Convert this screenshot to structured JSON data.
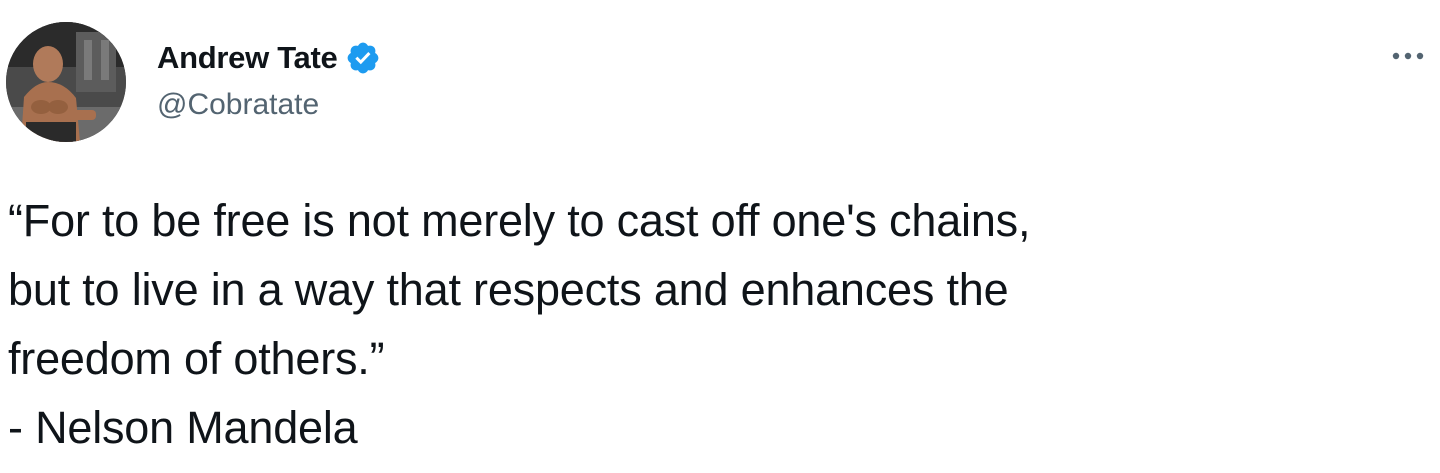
{
  "author": {
    "display_name": "Andrew Tate",
    "handle": "@Cobratate",
    "verified": true,
    "avatar_icon": "profile-photo",
    "verified_icon": "verified-badge-icon",
    "verified_color": "#1d9bf0"
  },
  "menu": {
    "icon": "more-options-icon",
    "color": "#536471"
  },
  "tweet": {
    "lines": [
      "“For to be free is not merely to cast off one's chains,",
      "but to live in a way that respects and enhances the",
      "freedom of others.”",
      "- Nelson Mandela"
    ]
  },
  "colors": {
    "text": "#0f1419",
    "secondary_text": "#536471",
    "background": "#ffffff"
  }
}
